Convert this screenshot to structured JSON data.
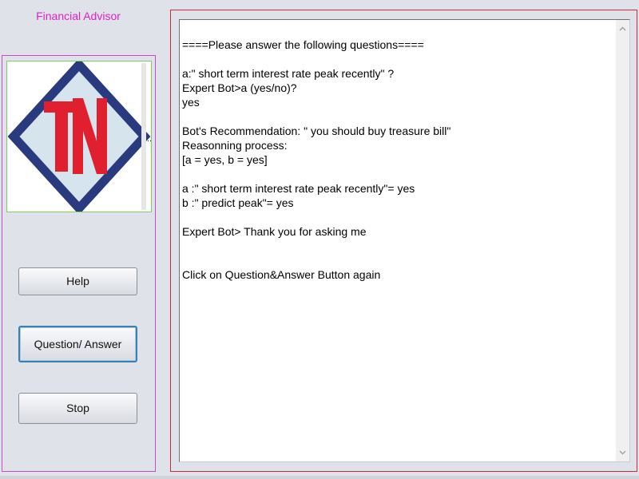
{
  "app": {
    "title": "Financial Advisor"
  },
  "logo": {
    "text": "TN",
    "icon": "tn-logo-icon",
    "colors": {
      "diamond_border": "#2a3a7e",
      "diamond_fill": "#d6e4ee",
      "letters": "#e0202e"
    },
    "overflow_marker": ".."
  },
  "buttons": {
    "help": "Help",
    "question_answer": "Question/ Answer",
    "stop": "Stop"
  },
  "transcript": {
    "lines": [
      "====Please answer the following questions====",
      "",
      "a:\" short term interest rate peak recently\" ?",
      "Expert Bot>a (yes/no)?",
      "yes",
      "",
      "Bot's Recommendation: \" you should buy treasure bill\"",
      "Reasonning process:",
      "[a = yes, b = yes]",
      "",
      "a :\" short term interest rate peak recently\"= yes",
      "b :\" predict peak\"= yes",
      "",
      "Expert Bot> Thank you for asking me",
      "",
      "",
      "Click on Question&Answer Button again"
    ]
  },
  "scrollbar": {
    "up_icon": "chevron-up-icon",
    "down_icon": "chevron-down-icon"
  },
  "colors": {
    "title": "#e020c8",
    "left_border": "#c44cc4",
    "right_border": "#d22a3a",
    "logo_border": "#80d060",
    "focus_border": "#3c7fb1"
  }
}
